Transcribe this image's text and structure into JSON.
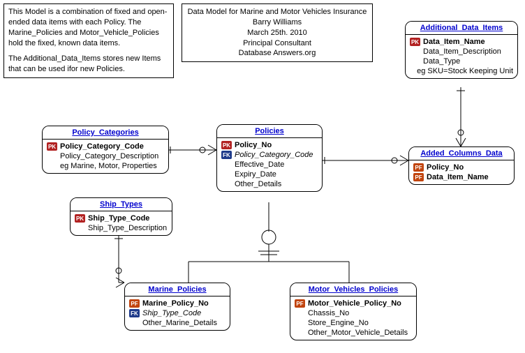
{
  "notes": {
    "intro": "This Model is a combination of fixed and open-ended data items with each Policy. The Marine_Policies and Motor_Vehicle_Policies hold the fixed, known data items.",
    "intro2": "The Additional_Data_Items stores new Items that can be used ifor new Policies."
  },
  "header": {
    "title": "Data Model  for Marine and Motor Vehicles Insurance",
    "author": "Barry Williams",
    "date": "March 25th. 2010",
    "role": "Principal Consultant",
    "source": "Database Answers.org"
  },
  "entities": {
    "policy_categories": {
      "name": "Policy_Categories",
      "attrs": {
        "pk": "Policy_Category_Code",
        "desc": "Policy_Category_Description",
        "eg": "eg Marine, Motor, Properties"
      }
    },
    "policies": {
      "name": "Policies",
      "attrs": {
        "pk": "Policy_No",
        "fk": "Policy_Category_Code",
        "eff": "Effective_Date",
        "exp": "Expiry_Date",
        "oth": "Other_Details"
      }
    },
    "additional_data_items": {
      "name": "Additional_Data_Items",
      "attrs": {
        "pk": "Data_Item_Name",
        "desc": "Data_Item_Description",
        "type": "Data_Type",
        "eg": "eg SKU=Stock Keeping Unit"
      }
    },
    "added_columns_data": {
      "name": "Added_Columns_Data",
      "attrs": {
        "pf1": "Policy_No",
        "pf2": "Data_Item_Name"
      }
    },
    "ship_types": {
      "name": "Ship_Types",
      "attrs": {
        "pk": "Ship_Type_Code",
        "desc": "Ship_Type_Description"
      }
    },
    "marine_policies": {
      "name": "Marine_Policies",
      "attrs": {
        "pf": "Marine_Policy_No",
        "fk": "Ship_Type_Code",
        "oth": "Other_Marine_Details"
      }
    },
    "motor_vehicles_policies": {
      "name": "Motor_Vehicles_Policies",
      "attrs": {
        "pf": "Motor_Vehicle_Policy_No",
        "ch": "Chassis_No",
        "se": "Store_Engine_No",
        "oth": "Other_Motor_Vehicle_Details"
      }
    }
  },
  "badges": {
    "pk": "PK",
    "fk": "FK",
    "pf": "PF"
  },
  "relationships": [
    {
      "from": "Policy_Categories",
      "to": "Policies",
      "type": "one-to-many"
    },
    {
      "from": "Policies",
      "to": "Added_Columns_Data",
      "type": "one-to-many"
    },
    {
      "from": "Additional_Data_Items",
      "to": "Added_Columns_Data",
      "type": "one-to-many"
    },
    {
      "from": "Policies",
      "to": "Marine_Policies",
      "type": "supertype-subtype"
    },
    {
      "from": "Policies",
      "to": "Motor_Vehicles_Policies",
      "type": "supertype-subtype"
    },
    {
      "from": "Ship_Types",
      "to": "Marine_Policies",
      "type": "one-to-many"
    }
  ]
}
